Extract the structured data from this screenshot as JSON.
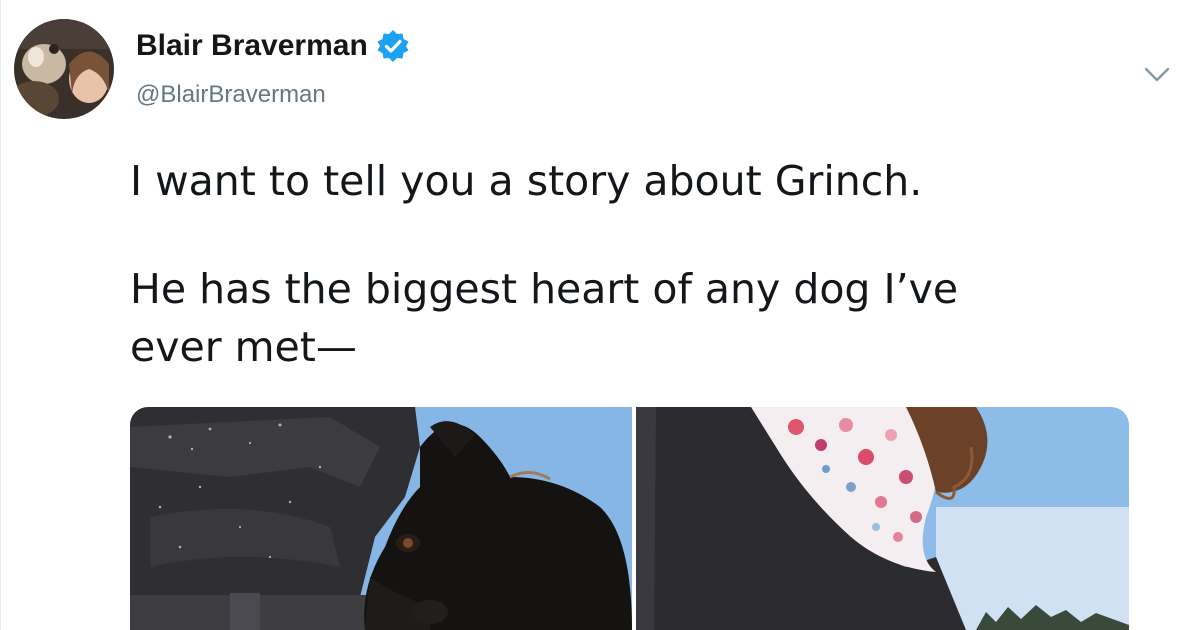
{
  "author": {
    "display_name": "Blair Braverman",
    "handle": "@BlairBraverman",
    "verified_icon": "verified-badge-icon",
    "avatar_icon": "profile-avatar"
  },
  "menu": {
    "icon": "chevron-down-icon"
  },
  "tweet": {
    "line_1": "I want to tell you a story about Grinch.",
    "line_2": "He has the biggest heart of any dog I’ve",
    "line_3": "ever met—"
  },
  "media": {
    "photos": [
      {
        "label": "dog-resting-head-photo"
      },
      {
        "label": "scarf-and-sky-photo"
      }
    ]
  },
  "colors": {
    "text": "#14171a",
    "secondary": "#657786",
    "verified": "#1da1f2",
    "sky": "#8dbce8"
  }
}
